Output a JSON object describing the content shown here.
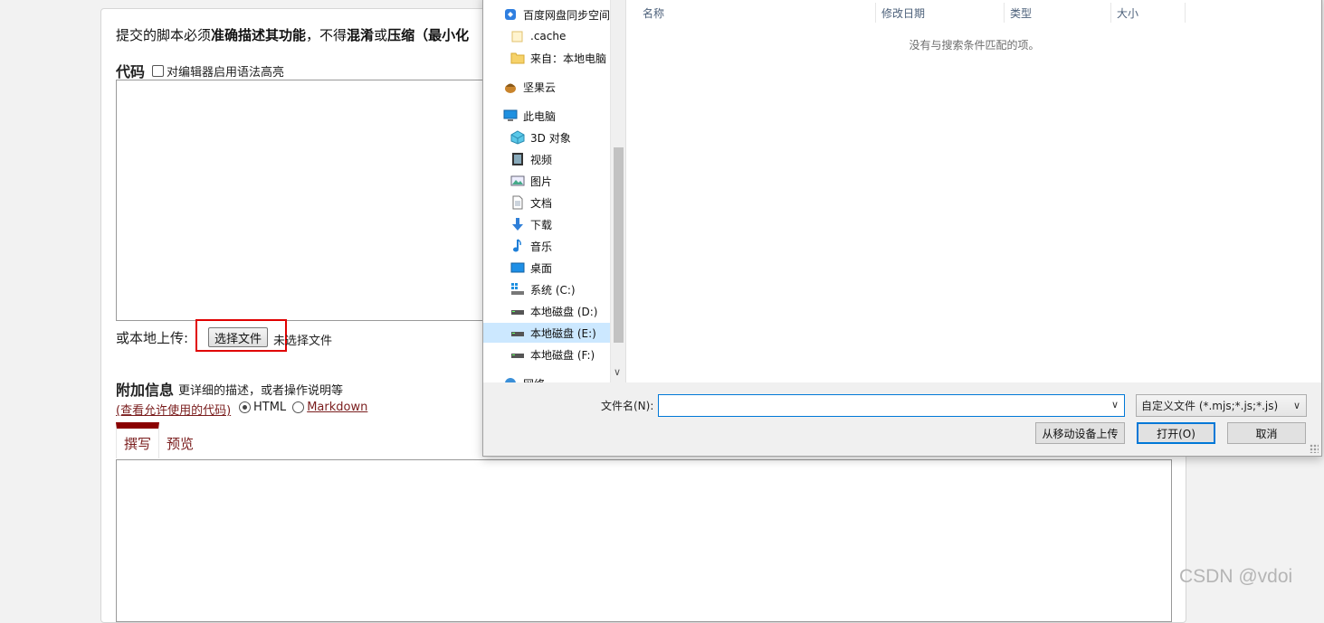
{
  "page": {
    "notice": {
      "t1": "提交的脚本必须",
      "b1": "准确描述其功能",
      "t2": "，不得",
      "b2": "混淆",
      "t3": "或",
      "b3": "压缩（最小化"
    },
    "code_heading": "代码",
    "syntax_label": "对编辑器启用语法高亮",
    "upload_label": "或本地上传:",
    "choose_file_label": "选择文件",
    "no_file_text": "未选择文件",
    "extra_heading": "附加信息",
    "extra_desc": "更详细的描述，或者操作说明等",
    "allowed_code_link": "(查看允许使用的代码)",
    "format_html": "HTML",
    "format_markdown": "Markdown",
    "tab_write": "撰写",
    "tab_preview": "预览"
  },
  "dialog": {
    "nav_items": [
      {
        "label": "百度网盘同步空间",
        "icon": "baidu-sync-icon"
      },
      {
        "label": ".cache",
        "icon": "folder-icon"
      },
      {
        "label": "来自：本地电脑",
        "icon": "folder-icon"
      },
      {
        "label": "坚果云",
        "icon": "jianguoyun-icon"
      },
      {
        "label": "此电脑",
        "icon": "computer-icon"
      },
      {
        "label": "3D 对象",
        "icon": "3d-objects-icon"
      },
      {
        "label": "视频",
        "icon": "video-icon"
      },
      {
        "label": "图片",
        "icon": "picture-icon"
      },
      {
        "label": "文档",
        "icon": "document-icon"
      },
      {
        "label": "下载",
        "icon": "download-icon"
      },
      {
        "label": "音乐",
        "icon": "music-icon"
      },
      {
        "label": "桌面",
        "icon": "desktop-icon"
      },
      {
        "label": "系统 (C:)",
        "icon": "system-drive-icon"
      },
      {
        "label": "本地磁盘 (D:)",
        "icon": "drive-icon"
      },
      {
        "label": "本地磁盘 (E:)",
        "icon": "drive-icon"
      },
      {
        "label": "本地磁盘 (F:)",
        "icon": "drive-icon"
      },
      {
        "label": "网络",
        "icon": "network-icon"
      }
    ],
    "selected_item": "本地磁盘 (E:)",
    "columns": [
      "名称",
      "修改日期",
      "类型",
      "大小"
    ],
    "empty_message": "没有与搜索条件匹配的项。",
    "filename_label": "文件名(N):",
    "filename_value": "",
    "filetype_value": "自定义文件 (*.mjs;*.js;*.js)",
    "upload_mobile_label": "从移动设备上传",
    "open_label": "打开(O)",
    "cancel_label": "取消"
  },
  "watermark": "CSDN @vdoi"
}
